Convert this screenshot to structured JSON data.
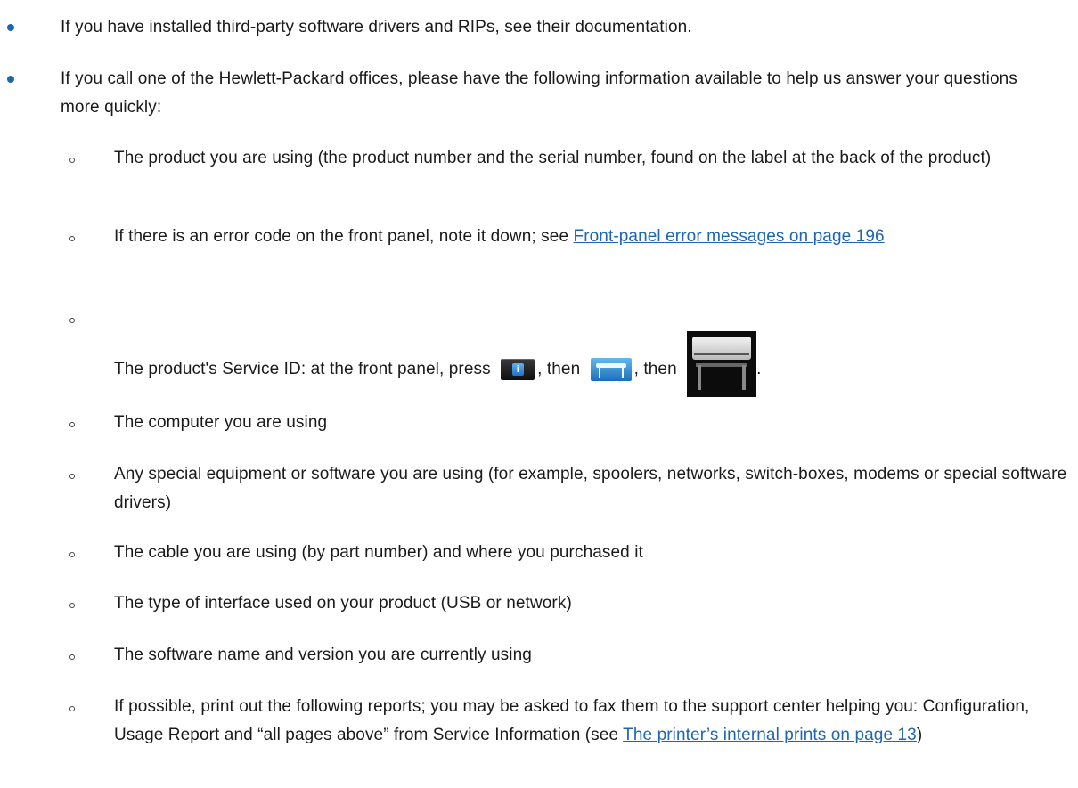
{
  "bullets": {
    "b1": "If you have installed third-party software drivers and RIPs, see their documentation.",
    "b2": "If you call one of the Hewlett-Packard offices, please have the following information available to help us answer your questions more quickly:"
  },
  "subitems": {
    "s1": "The product you are using (the product number and the serial number, found on the label at the back of the product)",
    "s2_pre": "If there is an error code on the front panel, note it down; see ",
    "s2_link": "Front-panel error messages on page 196",
    "s3_pre": "The product's Service ID: at the front panel, press ",
    "s3_mid1": ", then ",
    "s3_mid2": ", then ",
    "s3_end": ".",
    "s4": "The computer you are using",
    "s5": "Any special equipment or software you are using (for example, spoolers, networks, switch-boxes, modems or special software drivers)",
    "s6": "The cable you are using (by part number) and where you purchased it",
    "s7": "The type of interface used on your product (USB or network)",
    "s8": "The software name and version you are currently using",
    "s9_pre": "If possible, print out the following reports; you may be asked to fax them to the support center helping you: Configuration, Usage Report and “all pages above” from Service Information (see ",
    "s9_link": "The printer’s internal prints on page 13",
    "s9_end": ")"
  },
  "icons": {
    "info_letter": "i",
    "info": "info-icon",
    "printer_small": "printer-icon",
    "printer_large": "printer-image"
  },
  "colors": {
    "link": "#1f66b1",
    "bullet": "#1f66b1"
  }
}
